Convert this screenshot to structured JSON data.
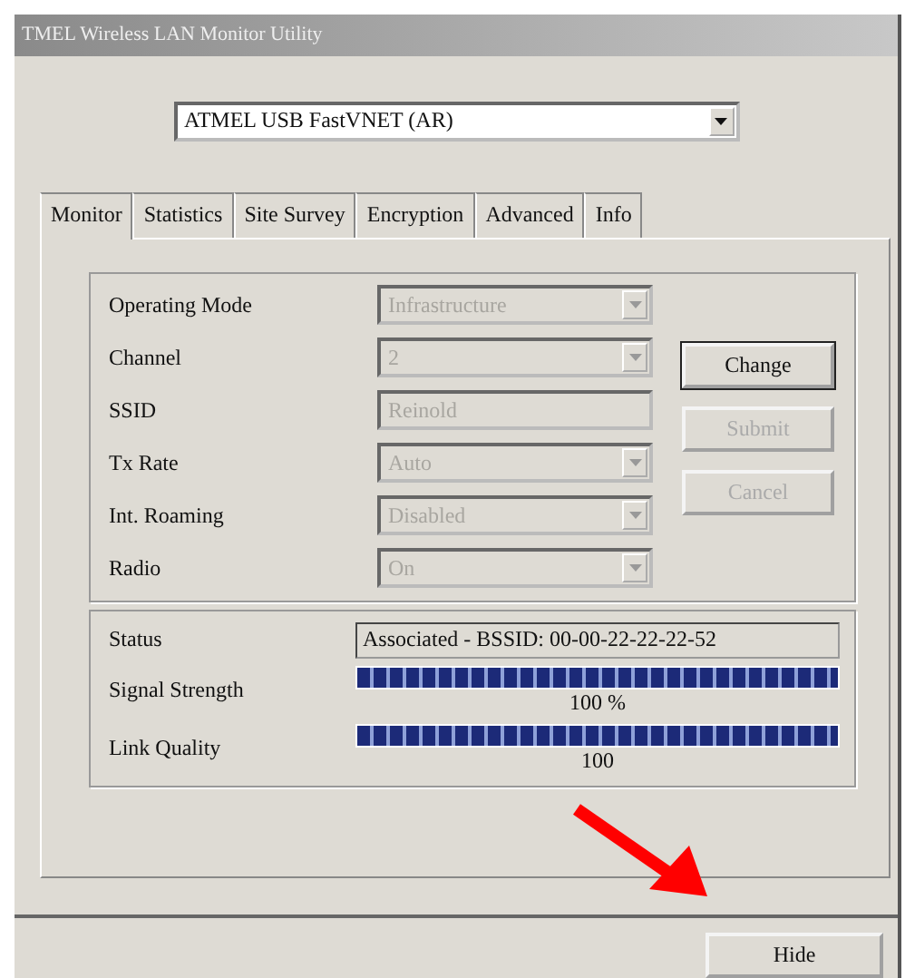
{
  "window": {
    "title": "TMEL Wireless LAN Monitor Utility"
  },
  "device_select": {
    "value": "ATMEL USB FastVNET (AR)"
  },
  "tabs": [
    {
      "label": "Monitor",
      "selected": true
    },
    {
      "label": "Statistics",
      "selected": false
    },
    {
      "label": "Site Survey",
      "selected": false
    },
    {
      "label": "Encryption",
      "selected": false
    },
    {
      "label": "Advanced",
      "selected": false
    },
    {
      "label": "Info",
      "selected": false
    }
  ],
  "settings": [
    {
      "label": "Operating Mode",
      "kind": "dropdown",
      "value": "Infrastructure",
      "disabled": true
    },
    {
      "label": "Channel",
      "kind": "dropdown",
      "value": "2",
      "disabled": true
    },
    {
      "label": "SSID",
      "kind": "text",
      "value": "Reinold",
      "disabled": true
    },
    {
      "label": "Tx Rate",
      "kind": "dropdown",
      "value": "Auto",
      "disabled": true
    },
    {
      "label": "Int. Roaming",
      "kind": "dropdown",
      "value": "Disabled",
      "disabled": true
    },
    {
      "label": "Radio",
      "kind": "dropdown",
      "value": "On",
      "disabled": true
    }
  ],
  "setting_buttons": [
    {
      "label": "Change",
      "disabled": false,
      "default": true
    },
    {
      "label": "Submit",
      "disabled": true,
      "default": false
    },
    {
      "label": "Cancel",
      "disabled": true,
      "default": false
    }
  ],
  "status": {
    "label": "Status",
    "value": "Associated - BSSID: 00-00-22-22-22-52"
  },
  "meters": [
    {
      "label": "Signal Strength",
      "level": 1,
      "reading": "100 %"
    },
    {
      "label": "Link Quality",
      "level": 1,
      "reading": "100"
    }
  ],
  "buttons": [
    {
      "label": "Hide"
    }
  ]
}
